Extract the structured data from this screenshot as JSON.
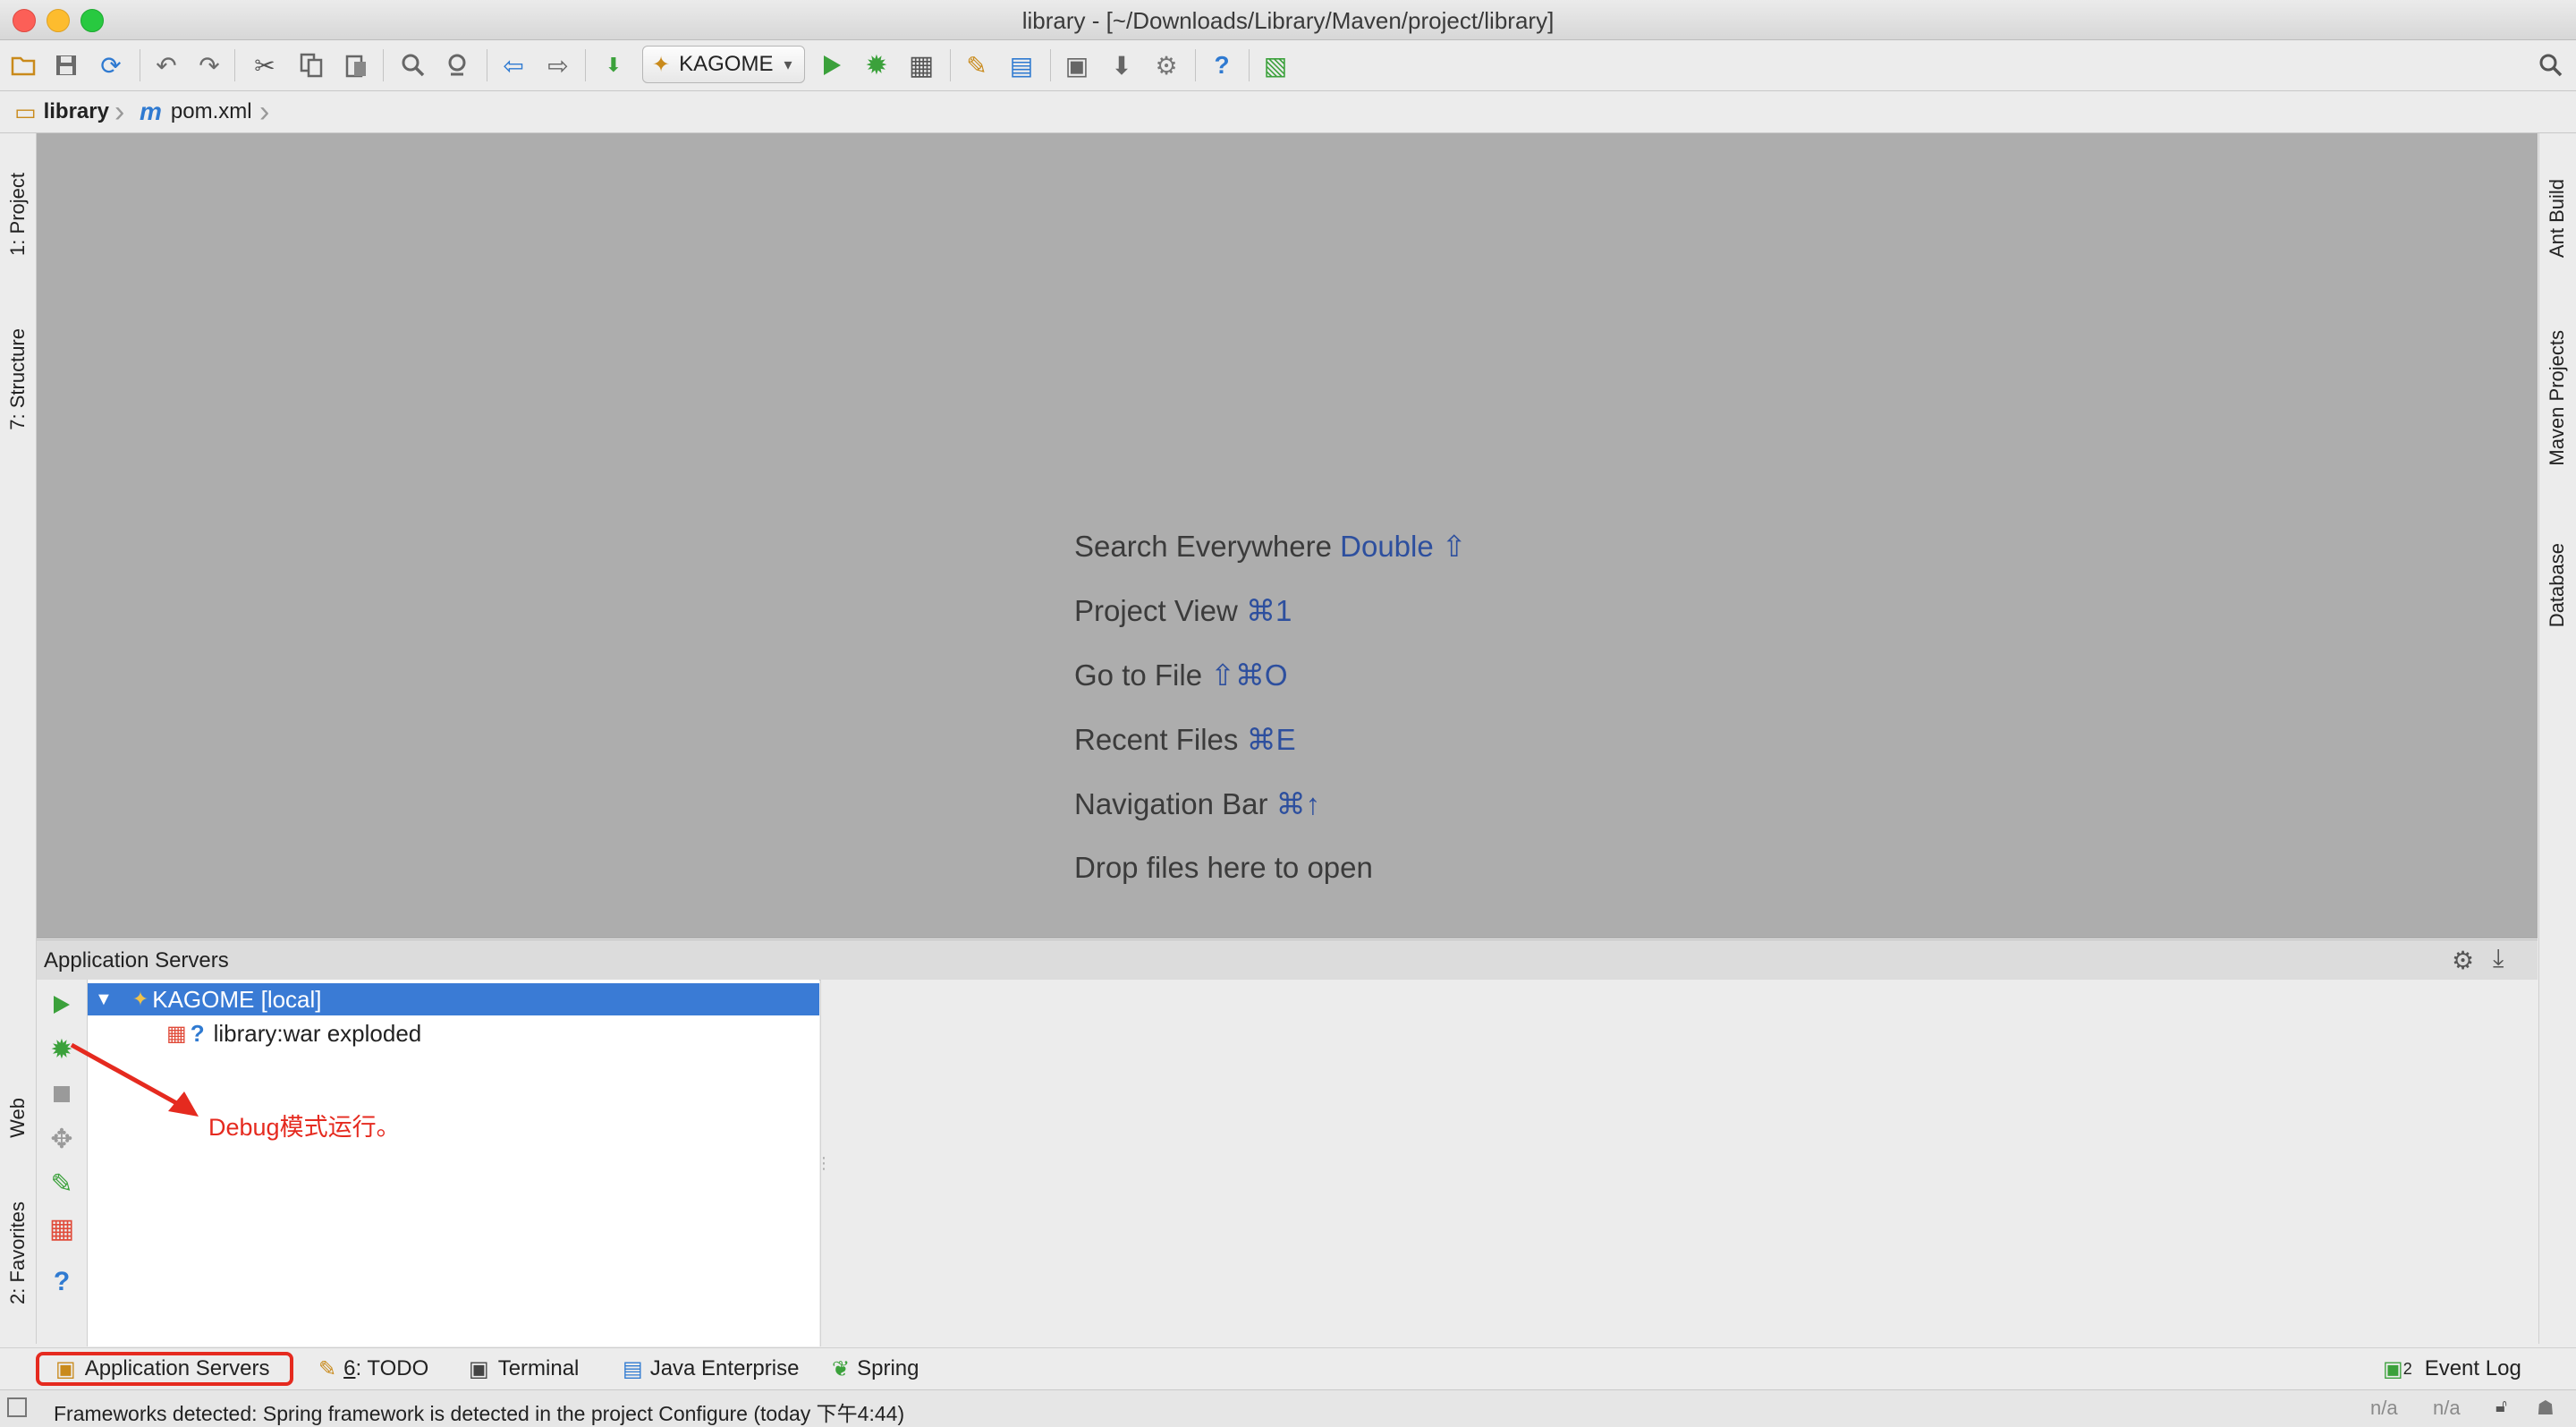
{
  "window": {
    "title": "library - [~/Downloads/Library/Maven/project/library]"
  },
  "toolbar": {
    "run_config": "KAGOME",
    "icons": [
      "open-folder-icon",
      "save-icon",
      "sync-icon",
      "undo-icon",
      "redo-icon",
      "cut-icon",
      "copy-icon",
      "paste-icon",
      "find-icon",
      "replace-icon",
      "back-icon",
      "forward-icon",
      "build-icon",
      "run-icon",
      "debug-icon",
      "coverage-icon",
      "settings-icon",
      "project-structure-icon",
      "sdk-icon",
      "download-icon",
      "android-icon",
      "help-icon",
      "vcs-icon",
      "search-icon"
    ]
  },
  "breadcrumb": {
    "project": "library",
    "file": "pom.xml"
  },
  "left_tabs": {
    "project": "1: Project",
    "structure": "7: Structure",
    "web": "Web",
    "favorites": "2: Favorites"
  },
  "right_tabs": {
    "ant": "Ant Build",
    "maven": "Maven Projects",
    "database": "Database"
  },
  "editor_hints": [
    {
      "text": "Search Everywhere",
      "shortcut": "Double ⇧"
    },
    {
      "text": "Project View",
      "shortcut": "⌘1"
    },
    {
      "text": "Go to File",
      "shortcut": "⇧⌘O"
    },
    {
      "text": "Recent Files",
      "shortcut": "⌘E"
    },
    {
      "text": "Navigation Bar",
      "shortcut": "⌘↑"
    },
    {
      "text": "Drop files here to open",
      "shortcut": ""
    }
  ],
  "app_servers": {
    "title": "Application Servers",
    "server": "KAGOME [local]",
    "artifact": "library:war exploded"
  },
  "annotation": {
    "text": "Debug模式运行。",
    "color": "#e52a1f"
  },
  "bottom_tabs": {
    "app_servers": "Application Servers",
    "todo_num": "6",
    "todo": ": TODO",
    "terminal": "Terminal",
    "java_ee": "Java Enterprise",
    "spring": "Spring",
    "event_log_num": "2",
    "event_log": "Event Log"
  },
  "status": {
    "message": "Frameworks detected: Spring framework is detected in the project Configure (today 下午4:44)",
    "pos1": "n/a",
    "pos2": "n/a"
  },
  "colors": {
    "selection": "#3a7bd5",
    "editor_bg": "#adadad",
    "run_green": "#3ba13b",
    "highlight": "#e52a1f"
  }
}
